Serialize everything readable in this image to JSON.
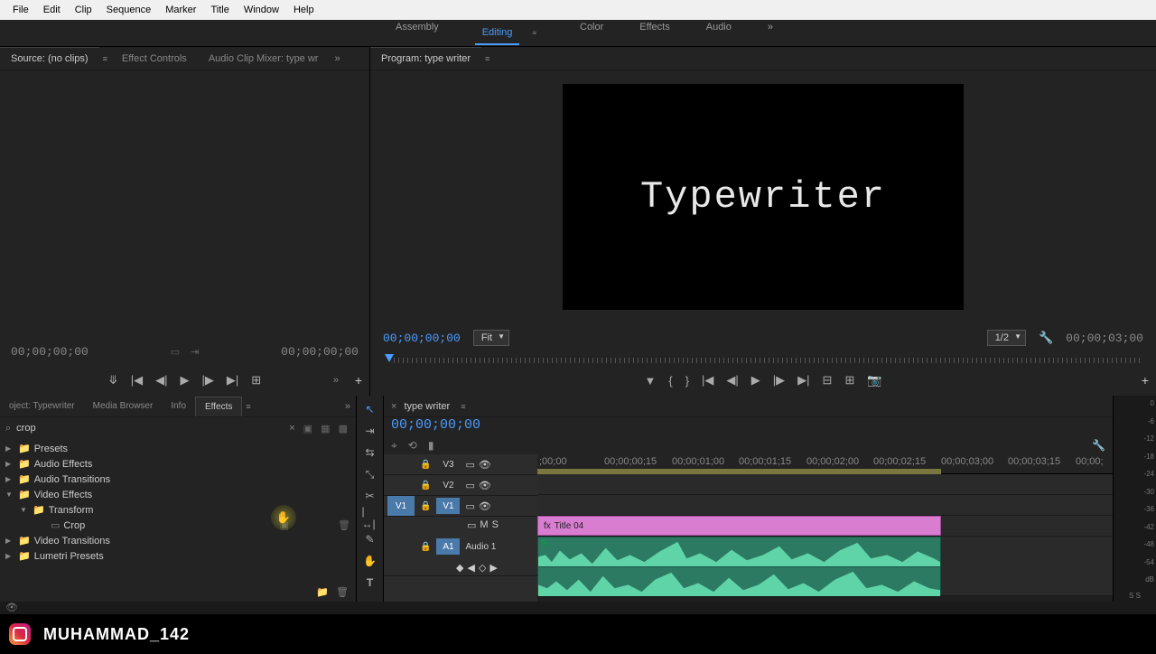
{
  "menu": [
    "File",
    "Edit",
    "Clip",
    "Sequence",
    "Marker",
    "Title",
    "Window",
    "Help"
  ],
  "workspaces": {
    "items": [
      "Assembly",
      "Editing",
      "Color",
      "Effects",
      "Audio"
    ],
    "active": "Editing"
  },
  "source_tabs": {
    "t1": "Source: (no clips)",
    "t2": "Effect Controls",
    "t3": "Audio Clip Mixer: type wr"
  },
  "program_tab": "Program: type writer",
  "source_tc_left": "00;00;00;00",
  "source_tc_right": "00;00;00;00",
  "program_tc_left": "00;00;00;00",
  "program_tc_right": "00;00;03;00",
  "fit_label": "Fit",
  "res_label": "1/2",
  "preview_text": "Typewriter",
  "bottom_tabs": {
    "t1": "oject: Typewriter",
    "t2": "Media Browser",
    "t3": "Info",
    "t4": "Effects"
  },
  "search_value": "crop",
  "tree": {
    "presets": "Presets",
    "audio_fx": "Audio Effects",
    "audio_tr": "Audio Transitions",
    "video_fx": "Video Effects",
    "transform": "Transform",
    "crop": "Crop",
    "video_tr": "Video Transitions",
    "lumetri": "Lumetri Presets"
  },
  "sequence_name": "type writer",
  "timeline_tc": "00;00;00;00",
  "ruler_labels": [
    ";00;00",
    "00;00;00;15",
    "00;00;01;00",
    "00;00;01;15",
    "00;00;02;00",
    "00;00;02;15",
    "00;00;03;00",
    "00;00;03;15",
    "00;00;"
  ],
  "tracks": {
    "v3": "V3",
    "v2": "V2",
    "v1": "V1",
    "v1src": "V1",
    "a1": "A1",
    "a1label": "Audio 1"
  },
  "clip_name": "Title 04",
  "meter_labels": [
    "0",
    "-6",
    "-12",
    "-18",
    "-24",
    "-30",
    "-36",
    "-42",
    "-48",
    "-54",
    "dB"
  ],
  "meter_foot": "S  S",
  "handle": "MUHAMMAD_142",
  "ms": {
    "m": "M",
    "s": "S"
  }
}
